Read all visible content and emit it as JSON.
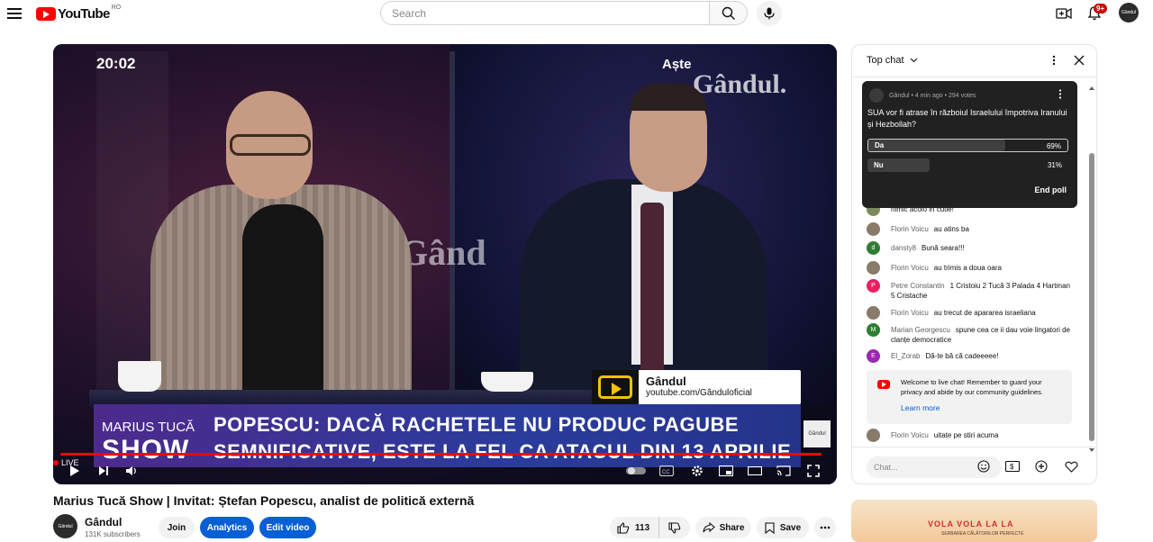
{
  "header": {
    "logo_text": "YouTube",
    "country": "RO",
    "search_placeholder": "Search",
    "notifications_count": "9+",
    "avatar_text": "Gândul"
  },
  "video": {
    "overlay_time": "20:02",
    "overlay_top_right": "Aște",
    "watermark": "Gândul.",
    "watermark_mid": "Gând",
    "channel_bug_name": "Gândul",
    "channel_bug_url": "youtube.com/Gânduloficial",
    "show_name_small": "MARIUS TUCĂ",
    "show_name_big": "SHOW",
    "headline_line1": "POPESCU: DACĂ RACHETELE NU PRODUC PAGUBE",
    "headline_line2": "SEMNIFICATIVE, ESTE LA FEL CA ATACUL DIN 13 APRILIE",
    "mini_logo": "Gândul",
    "live_label": "LIVE",
    "progress_fraction": 0.99
  },
  "meta": {
    "title": "Marius Tucă Show | Invitat: Ștefan Popescu, analist de politică externă",
    "channel_name": "Gândul",
    "channel_avatar_text": "Gândul",
    "subscribers": "131K subscribers",
    "join_label": "Join",
    "analytics_label": "Analytics",
    "edit_label": "Edit video",
    "like_count": "113",
    "share_label": "Share",
    "save_label": "Save"
  },
  "chat": {
    "header_label": "Top chat",
    "poll": {
      "meta": "Gândul • 4 min ago • 294 votes",
      "question": "SUA vor fi atrase în războiul Israelului împotriva Iranului și Hezbollah?",
      "options": [
        {
          "label": "Da",
          "percent": "69%",
          "fraction": 0.69
        },
        {
          "label": "Nu",
          "percent": "31%",
          "fraction": 0.31
        }
      ],
      "end_label": "End poll"
    },
    "messages": [
      {
        "author": "",
        "text": "nimic acolo in cutie!",
        "color": "#7a8a5a"
      },
      {
        "author": "Florin Voicu",
        "text": "au atins ba",
        "color": "#8a7a6a"
      },
      {
        "author": "dansty8",
        "text": "Bună seara!!!",
        "color": "#2e7d32",
        "initial": "d"
      },
      {
        "author": "Florin Voicu",
        "text": "au trimis a doua oara",
        "color": "#8a7a6a"
      },
      {
        "author": "Petre Constantin",
        "text": "1 Cristoiu 2 Tucă 3 Palada 4 Hartman 5 Cristache",
        "color": "#e91e63",
        "initial": "P"
      },
      {
        "author": "Florin Voicu",
        "text": "au trecut de apararea israeliana",
        "color": "#8a7a6a"
      },
      {
        "author": "Marian Georgescu",
        "text": "spune cea ce ii dau voie lingatori de clanțe democratice",
        "color": "#2e7d32",
        "initial": "M"
      },
      {
        "author": "El_Zorab",
        "text": "Dă-te bă că cadeeeee!",
        "color": "#9c27b0",
        "initial": "E"
      },
      {
        "author": "Florin Voicu",
        "text": "uitate pe stiri acuma",
        "color": "#8a7a6a"
      }
    ],
    "welcome_text": "Welcome to live chat! Remember to guard your privacy and abide by our community guidelines.",
    "learn_more": "Learn more",
    "input_placeholder": "Chat..."
  },
  "ad": {
    "text": "VOLA VOLA LA LA",
    "subtext": "SERBAREA CĂLĂTORILOR PERFECTE"
  }
}
